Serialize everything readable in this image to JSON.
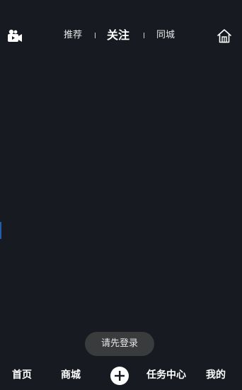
{
  "header": {
    "tabs": [
      {
        "label": "推荐",
        "active": false
      },
      {
        "label": "关注",
        "active": true
      },
      {
        "label": "同城",
        "active": false
      }
    ],
    "left_icon": "video-camera-icon",
    "right_icon": "home-icon"
  },
  "toast": {
    "message": "请先登录"
  },
  "bottom_nav": {
    "items": [
      {
        "label": "首页"
      },
      {
        "label": "商城"
      },
      {
        "label": "任务中心"
      },
      {
        "label": "我的"
      }
    ],
    "center_icon": "plus-icon"
  },
  "colors": {
    "background": "#171a21",
    "text": "#ffffff",
    "toast_background": "#3a3b3d"
  }
}
